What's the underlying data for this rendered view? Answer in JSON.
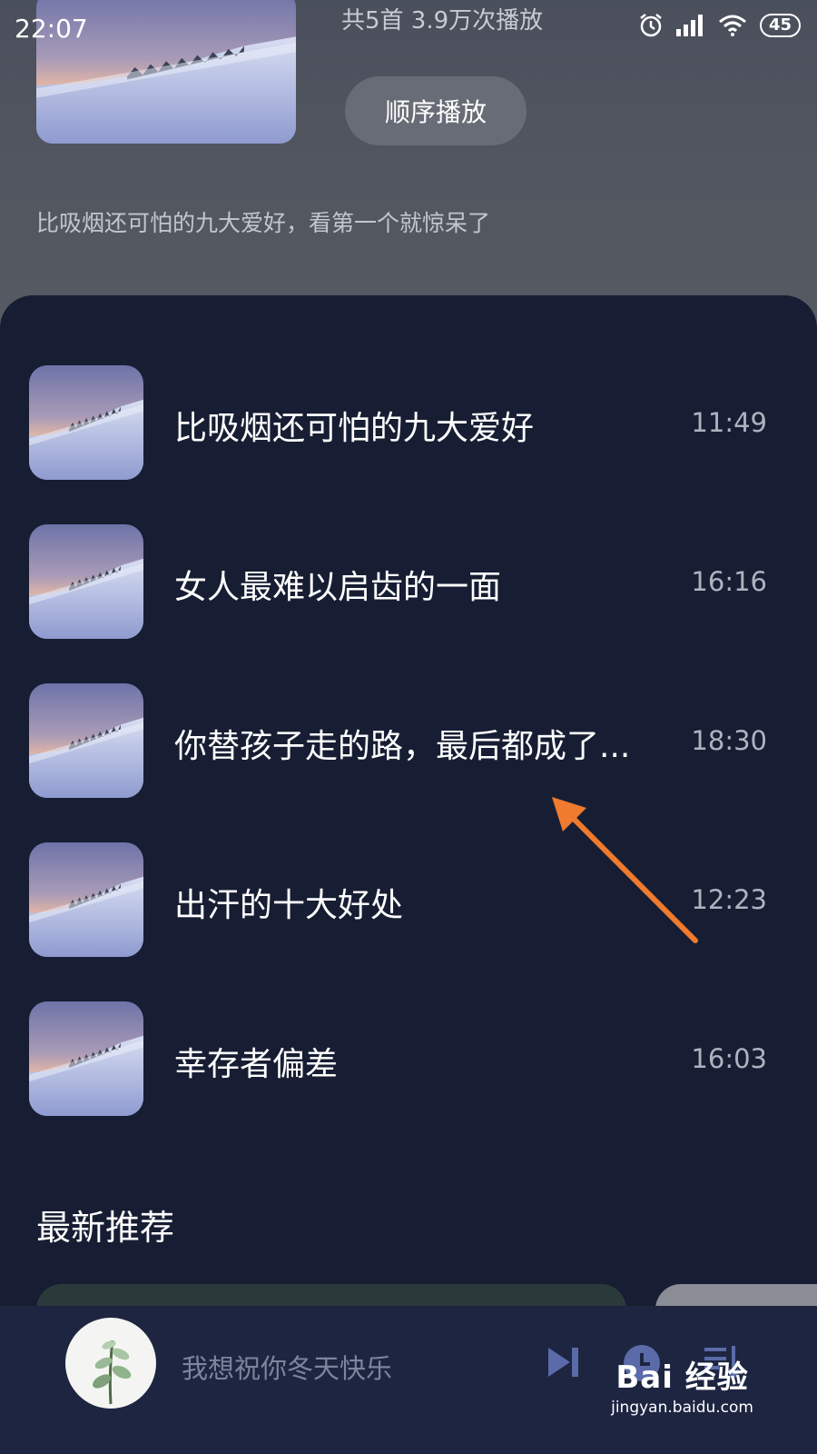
{
  "status_bar": {
    "time": "22:07",
    "battery": "45",
    "icons": [
      "alarm-icon",
      "signal-icon",
      "wifi-icon",
      "battery-icon"
    ]
  },
  "album": {
    "meta": "共5首  3.9万次播放",
    "play_button_label": "顺序播放",
    "description": "比吸烟还可怕的九大爱好，看第一个就惊呆了"
  },
  "tracks": [
    {
      "title": "比吸烟还可怕的九大爱好",
      "duration": "11:49"
    },
    {
      "title": "女人最难以启齿的一面",
      "duration": "16:16"
    },
    {
      "title": "你替孩子走的路，最后都成了...",
      "duration": "18:30"
    },
    {
      "title": "出汗的十大好处",
      "duration": "12:23"
    },
    {
      "title": "幸存者偏差",
      "duration": "16:03"
    }
  ],
  "recommend": {
    "section_title": "最新推荐"
  },
  "player": {
    "now_playing": "我想祝你冬天快乐",
    "controls": [
      "play-next-icon",
      "clock-icon",
      "playlist-icon"
    ]
  },
  "watermark": {
    "logo": "Bai 经验",
    "url": "jingyan.baidu.com"
  },
  "colors": {
    "panel_bg": "#171e33",
    "player_bg": "#1d2541",
    "annotation_arrow": "#f07a2e"
  }
}
